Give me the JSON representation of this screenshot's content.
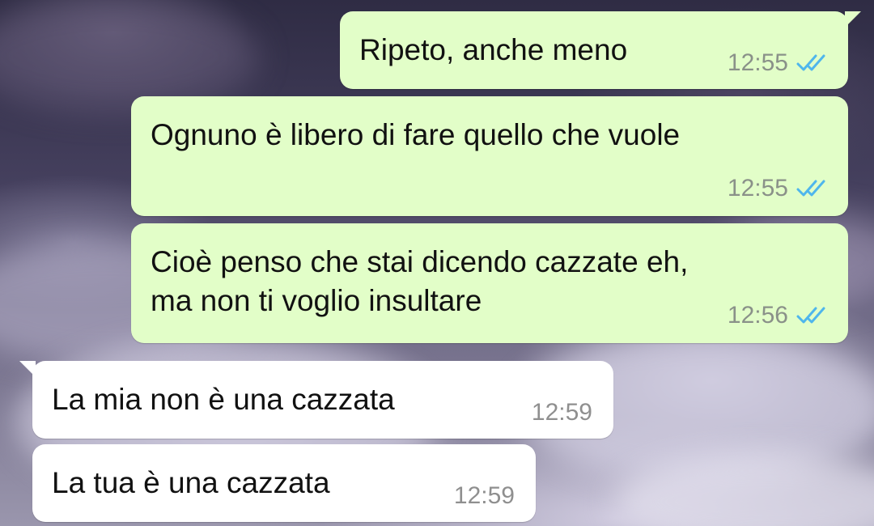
{
  "chat": {
    "messages": [
      {
        "direction": "outgoing",
        "text": "Ripeto, anche meno",
        "time": "12:55",
        "status_icon": "double-check-read-icon"
      },
      {
        "direction": "outgoing",
        "text": "Ognuno è libero di fare quello che vuole",
        "time": "12:55",
        "status_icon": "double-check-read-icon"
      },
      {
        "direction": "outgoing",
        "text": "Cioè penso che stai dicendo cazzate eh,\nma non ti voglio insultare",
        "time": "12:56",
        "status_icon": "double-check-read-icon"
      },
      {
        "direction": "incoming",
        "text": "La mia non è una cazzata",
        "time": "12:59"
      },
      {
        "direction": "incoming",
        "text": "La tua è una cazzata",
        "time": "12:59"
      }
    ]
  },
  "colors": {
    "outgoing_bubble": "#e2fec8",
    "incoming_bubble": "#ffffff",
    "read_tick": "#4fb6ec",
    "timestamp": "#8a9189"
  }
}
